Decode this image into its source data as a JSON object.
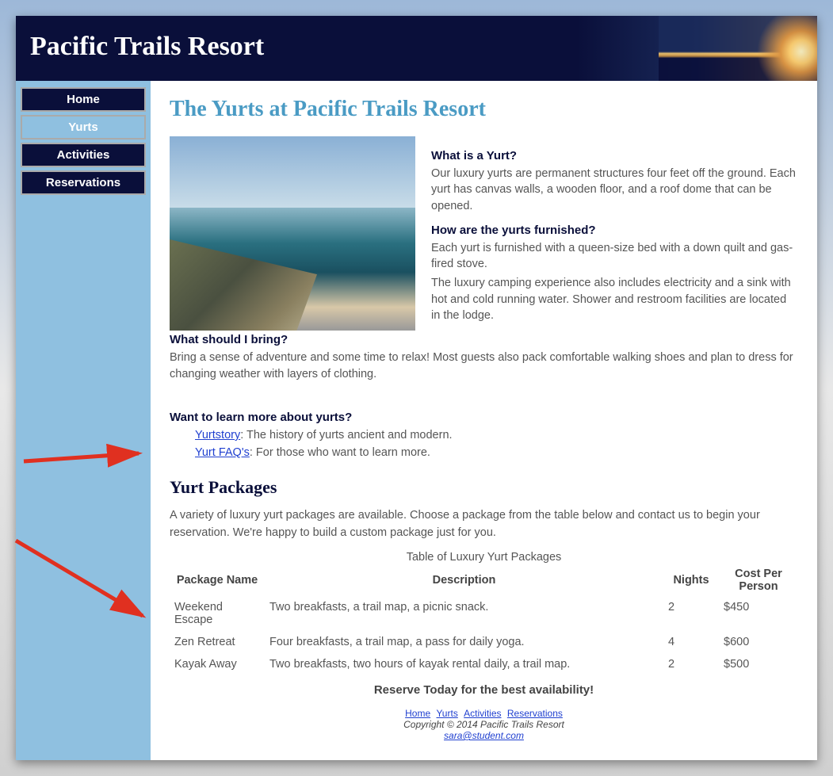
{
  "header": {
    "title": "Pacific Trails Resort"
  },
  "nav": {
    "items": [
      {
        "label": "Home",
        "active": false
      },
      {
        "label": "Yurts",
        "active": true
      },
      {
        "label": "Activities",
        "active": false
      },
      {
        "label": "Reservations",
        "active": false
      }
    ]
  },
  "page": {
    "title": "The Yurts at Pacific Trails Resort"
  },
  "faq": {
    "q1": "What is a Yurt?",
    "a1": "Our luxury yurts are permanent structures four feet off the ground. Each yurt has canvas walls, a wooden floor, and a roof dome that can be opened.",
    "q2": "How are the yurts furnished?",
    "a2a": "Each yurt is furnished with a queen-size bed with a down quilt and gas-fired stove.",
    "a2b": "The luxury camping experience also includes electricity and a sink with hot and cold running water. Shower and restroom facilities are located in the lodge.",
    "q3": "What should I bring?",
    "a3": "Bring a sense of adventure and some time to relax! Most guests also pack comfortable walking shoes and plan to dress for changing weather with layers of clothing."
  },
  "learn": {
    "heading": "Want to learn more about yurts?",
    "link1_text": "Yurtstory",
    "link1_desc": ": The history of yurts ancient and modern.",
    "link2_text": "Yurt FAQ's",
    "link2_desc": ": For those who want to learn more."
  },
  "packages": {
    "heading": "Yurt Packages",
    "intro": "A variety of luxury yurt packages are available. Choose a package from the table below and contact us to begin your reservation. We're happy to build a custom package just for you.",
    "caption": "Table of Luxury Yurt Packages",
    "columns": [
      "Package Name",
      "Description",
      "Nights",
      "Cost Per Person"
    ],
    "rows": [
      {
        "name": "Weekend Escape",
        "desc": "Two breakfasts, a trail map, a picnic snack.",
        "nights": "2",
        "cost": "$450"
      },
      {
        "name": "Zen Retreat",
        "desc": "Four breakfasts, a trail map, a pass for daily yoga.",
        "nights": "4",
        "cost": "$600"
      },
      {
        "name": "Kayak Away",
        "desc": "Two breakfasts, two hours of kayak rental daily, a trail map.",
        "nights": "2",
        "cost": "$500"
      }
    ],
    "cta": "Reserve Today for the best availability!"
  },
  "footer": {
    "links": [
      "Home",
      "Yurts",
      "Activities",
      "Reservations"
    ],
    "copyright": "Copyright © 2014 Pacific Trails Resort",
    "email": "sara@student.com"
  }
}
